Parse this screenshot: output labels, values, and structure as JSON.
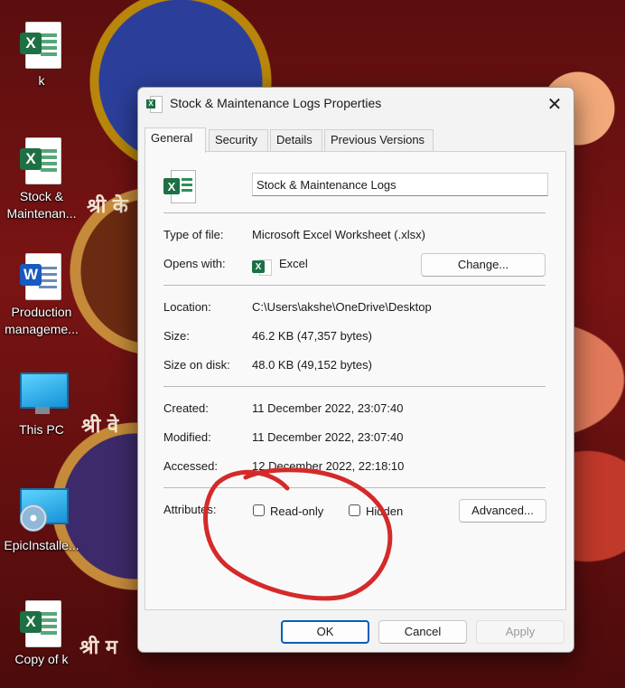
{
  "desktop": {
    "icons": [
      {
        "label": "k",
        "type": "excel"
      },
      {
        "label": "Stock & Maintenan...",
        "type": "excel"
      },
      {
        "label": "Production manageme...",
        "type": "word"
      },
      {
        "label": "This PC",
        "type": "monitor"
      },
      {
        "label": "EpicInstalle...",
        "type": "installer"
      },
      {
        "label": "Copy of k",
        "type": "excel"
      }
    ],
    "wallpaper_text": [
      "श्री के",
      "श्री वे",
      "श्री म"
    ]
  },
  "dialog": {
    "title": "Stock & Maintenance Logs Properties",
    "close_icon": "close-icon",
    "tabs": [
      "General",
      "Security",
      "Details",
      "Previous Versions"
    ],
    "active_tab": "General",
    "file_name": "Stock & Maintenance Logs",
    "type_label": "Type of file:",
    "type_value": "Microsoft Excel Worksheet (.xlsx)",
    "opens_label": "Opens with:",
    "opens_value": "Excel",
    "change_label": "Change...",
    "location_label": "Location:",
    "location_value": "C:\\Users\\akshe\\OneDrive\\Desktop",
    "size_label": "Size:",
    "size_value": "46.2 KB (47,357 bytes)",
    "size_disk_label": "Size on disk:",
    "size_disk_value": "48.0 KB (49,152 bytes)",
    "created_label": "Created:",
    "created_value": "11 December 2022, 23:07:40",
    "modified_label": "Modified:",
    "modified_value": "11 December 2022, 23:07:40",
    "accessed_label": "Accessed:",
    "accessed_value": "12 December 2022, 22:18:10",
    "attributes_label": "Attributes:",
    "readonly_label": "Read-only",
    "readonly_checked": false,
    "hidden_label": "Hidden",
    "hidden_checked": false,
    "advanced_label": "Advanced...",
    "ok_label": "OK",
    "cancel_label": "Cancel",
    "apply_label": "Apply"
  },
  "annotation": {
    "shape": "hand-drawn circle",
    "color": "#d42a2a"
  }
}
